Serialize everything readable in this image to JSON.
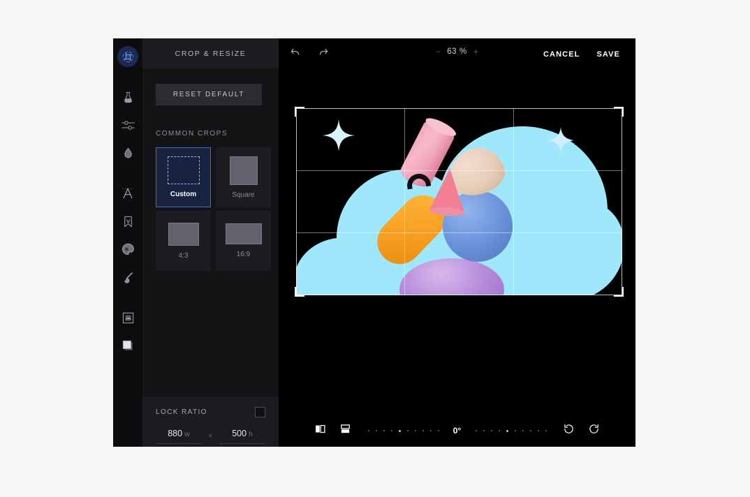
{
  "app": {
    "panel_title": "CROP & RESIZE"
  },
  "tool_rail": {
    "items": [
      {
        "name": "crop-resize",
        "icon": "crop-icon",
        "active": true
      },
      {
        "name": "adjust",
        "icon": "flask-icon",
        "active": false
      },
      {
        "name": "sliders",
        "icon": "sliders-icon",
        "active": false
      },
      {
        "name": "retouch",
        "icon": "droplet-icon",
        "active": false
      },
      {
        "name": "text",
        "icon": "text-a-icon",
        "active": false
      },
      {
        "name": "stickers",
        "icon": "bookmark-icon",
        "active": false
      },
      {
        "name": "paint",
        "icon": "palette-icon",
        "active": false
      },
      {
        "name": "brush",
        "icon": "brush-icon",
        "active": false
      },
      {
        "name": "frame",
        "icon": "frame-icon",
        "active": false
      },
      {
        "name": "overlay",
        "icon": "square-stack-icon",
        "active": false
      }
    ]
  },
  "sidebar": {
    "reset_label": "RESET DEFAULT",
    "common_crops_label": "COMMON CROPS",
    "crops": [
      {
        "label": "Custom",
        "shape": "custom",
        "selected": true
      },
      {
        "label": "Square",
        "shape": "square",
        "selected": false
      },
      {
        "label": "4:3",
        "shape": "r43",
        "selected": false
      },
      {
        "label": "16:9",
        "shape": "r169",
        "selected": false
      }
    ],
    "lock_ratio": {
      "label": "LOCK RATIO",
      "checked": false
    },
    "dimensions": {
      "width_value": "880",
      "width_unit": "w",
      "separator": "×",
      "height_value": "500",
      "height_unit": "h"
    }
  },
  "toolbar": {
    "undo": "undo-icon",
    "redo": "redo-icon",
    "zoom_out": "−",
    "zoom_in": "+",
    "zoom_value": "63 %",
    "cancel_label": "CANCEL",
    "save_label": "SAVE"
  },
  "bottom_bar": {
    "flip_horizontal": "flip-horizontal-icon",
    "flip_vertical": "flip-vertical-icon",
    "angle_value": "0°",
    "rotate_left": "rotate-left-icon",
    "rotate_right": "rotate-right-icon"
  },
  "canvas": {
    "artwork_description": "3D cloud with abstract shapes",
    "colors": {
      "cloud": "#9fe7fb",
      "pink_cylinder": "#f4a8bc",
      "blue_ball": "#6f97dd",
      "orange_capsule": "#f9a327",
      "pink_cone": "#f27f94",
      "purple_dome": "#b48ada",
      "beige_blob": "#e6cdb8",
      "accent": "#3f6fd1"
    }
  }
}
